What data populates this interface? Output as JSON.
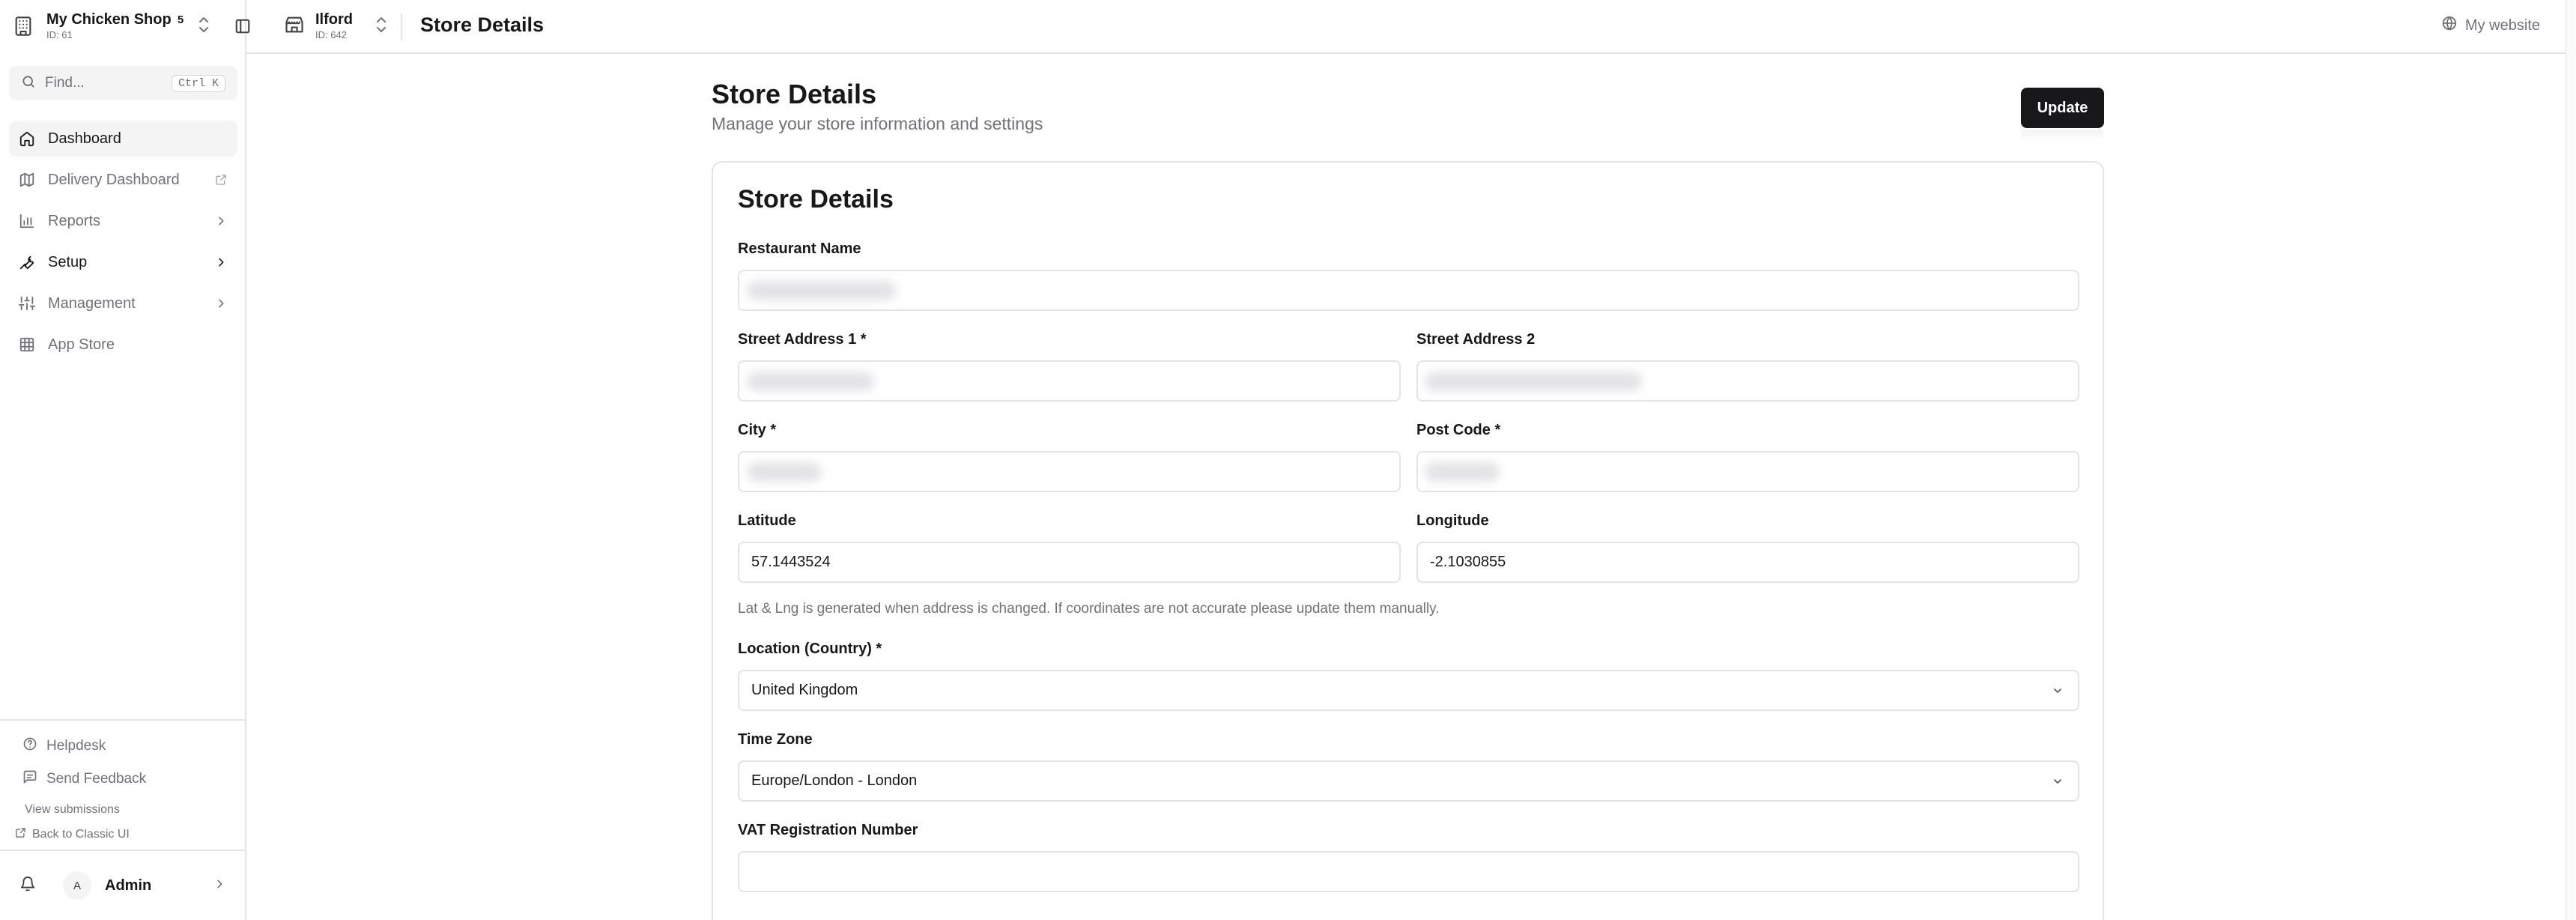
{
  "org": {
    "name": "My Chicken Shop",
    "id": "ID: 61",
    "badge": "5"
  },
  "search": {
    "placeholder": "Find...",
    "shortcut": "Ctrl K"
  },
  "nav": [
    {
      "label": "Dashboard",
      "icon": "home-icon"
    },
    {
      "label": "Delivery Dashboard",
      "icon": "map-icon"
    },
    {
      "label": "Reports",
      "icon": "bar-chart-icon"
    },
    {
      "label": "Setup",
      "icon": "wrench-icon"
    },
    {
      "label": "Management",
      "icon": "sliders-icon"
    },
    {
      "label": "App Store",
      "icon": "grid-icon"
    }
  ],
  "footer": {
    "helpdesk": "Helpdesk",
    "send_feedback": "Send Feedback",
    "view_submissions": "View submissions",
    "back_classic": "Back to Classic UI"
  },
  "user": {
    "initial": "A",
    "name": "Admin"
  },
  "store": {
    "name": "Ilford",
    "id": "ID: 642"
  },
  "topbar": {
    "title": "Store Details",
    "my_website": "My website"
  },
  "page": {
    "title": "Store Details",
    "subtitle": "Manage your store information and settings",
    "update_label": "Update"
  },
  "card": {
    "title": "Store Details",
    "restaurant_name_label": "Restaurant Name",
    "street1_label": "Street Address 1 *",
    "street2_label": "Street Address 2",
    "city_label": "City *",
    "postcode_label": "Post Code *",
    "latitude_label": "Latitude",
    "latitude_value": "57.1443524",
    "longitude_label": "Longitude",
    "longitude_value": "-2.1030855",
    "coords_hint": "Lat & Lng is generated when address is changed. If coordinates are not accurate please update them manually.",
    "country_label": "Location (Country) *",
    "country_value": "United Kingdom",
    "timezone_label": "Time Zone",
    "timezone_value": "Europe/London - London",
    "vat_label": "VAT Registration Number",
    "vat_value": ""
  }
}
